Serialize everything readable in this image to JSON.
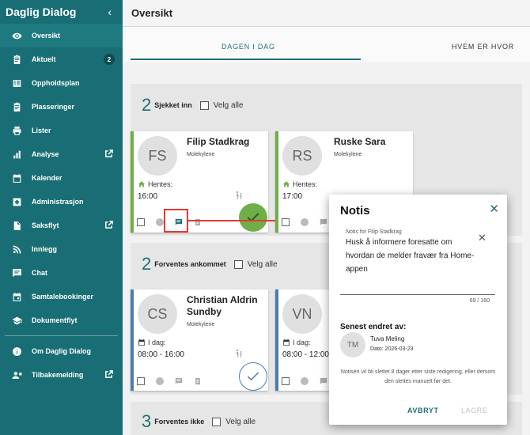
{
  "sidebar": {
    "title": "Daglig Dialog",
    "items": [
      {
        "label": "Oversikt",
        "icon": "eye-icon"
      },
      {
        "label": "Aktuelt",
        "icon": "clipboard-icon",
        "badge": "2"
      },
      {
        "label": "Oppholdsplan",
        "icon": "schedule-icon"
      },
      {
        "label": "Plasseringer",
        "icon": "assignment-icon"
      },
      {
        "label": "Lister",
        "icon": "printer-icon"
      },
      {
        "label": "Analyse",
        "icon": "bar-chart-icon"
      },
      {
        "label": "Kalender",
        "icon": "calendar-icon"
      },
      {
        "label": "Administrasjon",
        "icon": "admin-icon"
      },
      {
        "label": "Saksflyt",
        "icon": "document-icon"
      },
      {
        "label": "Innlegg",
        "icon": "rss-icon"
      },
      {
        "label": "Chat",
        "icon": "chat-icon"
      },
      {
        "label": "Samtalebookinger",
        "icon": "event-icon"
      },
      {
        "label": "Dokumentflyt",
        "icon": "graduation-cap-icon"
      },
      {
        "label": "Om Daglig Dialog",
        "icon": "info-icon"
      },
      {
        "label": "Tilbakemelding",
        "icon": "feedback-icon"
      }
    ]
  },
  "header": {
    "title": "Oversikt"
  },
  "tabs": {
    "today": "DAGEN I DAG",
    "who": "HVEM ER HVOR"
  },
  "sections": {
    "checked_in": {
      "count": "2",
      "label": "Sjekket inn",
      "select_all": "Velg alle"
    },
    "expected": {
      "count": "2",
      "label": "Forventes ankommet",
      "select_all": "Velg alle"
    },
    "not_expected": {
      "count": "3",
      "label": "Forventes ikke",
      "select_all": "Velg alle"
    }
  },
  "cards": {
    "filip": {
      "initials": "FS",
      "name": "Filip Stadkrag",
      "dept": "Molekylene",
      "label": "Hentes:",
      "time": "16:00"
    },
    "ruske": {
      "initials": "RS",
      "name": "Ruske Sara",
      "dept": "Molekylene",
      "label": "Hentes:",
      "time": "17:00"
    },
    "christian": {
      "initials": "CS",
      "name": "Christian Aldrin Sundby",
      "dept": "Molekylene",
      "label": "I dag:",
      "time": "08:00 - 16:00"
    },
    "vn": {
      "initials": "VN",
      "label": "I dag:",
      "time": "08:00 - 12:00"
    }
  },
  "dialog": {
    "title": "Notis",
    "note_label": "Notis for Filip Stadkrag",
    "note_text": "Husk å informere foresatte om hvordan de melder fravær fra Home-appen",
    "char_count": "69 / 160",
    "last_changed_heading": "Senest endret av:",
    "editor_initials": "TM",
    "editor_name": "Tuva Meling",
    "editor_date": "Dato: 2026-03-23",
    "info": "Notisen vil bli slettet 8 dager etter siste redigering, eller dersom den slettes manuelt før det.",
    "cancel": "AVBRYT",
    "save": "LAGRE"
  },
  "colors": {
    "sidebar": "#186e74",
    "accent": "#1e6f76",
    "green": "#6fae48",
    "blue_stripe": "#4b7db0",
    "highlight": "#e53935"
  }
}
